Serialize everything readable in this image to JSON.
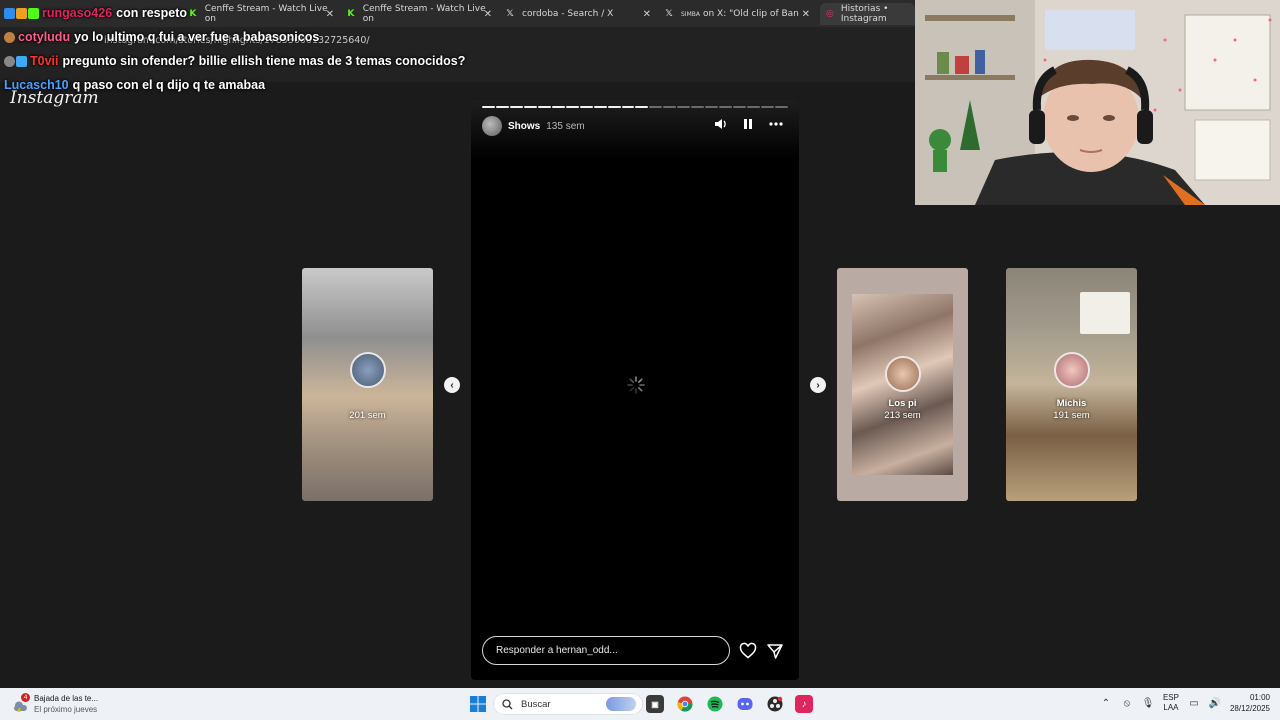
{
  "browser": {
    "tabs": [
      {
        "label": "",
        "icon": "twitch-icon",
        "color": "#9146ff"
      },
      {
        "label": "Cenffe Stream - Watch Live on",
        "icon": "kick-icon",
        "color": "#53fc18"
      },
      {
        "label": "Cenffe Stream - Watch Live on",
        "icon": "kick-icon",
        "color": "#53fc18"
      },
      {
        "label": "cordoba - Search / X",
        "icon": "x-icon",
        "color": "#ffffff"
      },
      {
        "label": "on X: \"Old clip of Ban",
        "icon": "x-icon",
        "color": "#ffffff"
      },
      {
        "label": "Historias • Instagram",
        "icon": "instagram-icon",
        "color": "#e1306c"
      }
    ],
    "tab_badge": "SIMBA",
    "url": "instagram.com/stories/highlights/17853000132725640/"
  },
  "chat": [
    {
      "user": "rungaso426",
      "user_color": "#e0245e",
      "message": "con respeto",
      "badges": [
        "#2d8cf0",
        "#f0a020",
        "#53fc18"
      ]
    },
    {
      "user": "cotyludu",
      "user_color": "#ff5c8a",
      "message": "yo lo ultimo q fui a ver fue a babasonicos",
      "badges": [
        "#c08040"
      ]
    },
    {
      "user": "T0vii",
      "user_color": "#ff3030",
      "message": "pregunto sin ofender? billie ellish tiene mas de 3 temas conocidos?",
      "badges": [
        "#888888",
        "#3fa9f5"
      ]
    },
    {
      "user": "Lucasch10",
      "user_color": "#4aa3ff",
      "message": "q paso con el q dijo q te amabaa",
      "badges": []
    }
  ],
  "instagram": {
    "logo": "Instagram",
    "story": {
      "name": "Shows",
      "time": "135 sem",
      "progress_segments_total": 22,
      "progress_segments_done": 12,
      "reply_placeholder": "Responder a hernan_odd..."
    },
    "cards": {
      "left": {
        "label": "201 sem"
      },
      "right1": {
        "name": "Los pi",
        "time": "213 sem"
      },
      "right2": {
        "name": "Michis",
        "time": "191 sem"
      }
    }
  },
  "taskbar": {
    "weather_title": "Bajada de las te...",
    "weather_sub": "El próximo jueves",
    "weather_badge": "4",
    "search": "Buscar",
    "lang_top": "ESP",
    "lang_bottom": "LAA",
    "time": "01:00",
    "date": "28/12/2025"
  }
}
